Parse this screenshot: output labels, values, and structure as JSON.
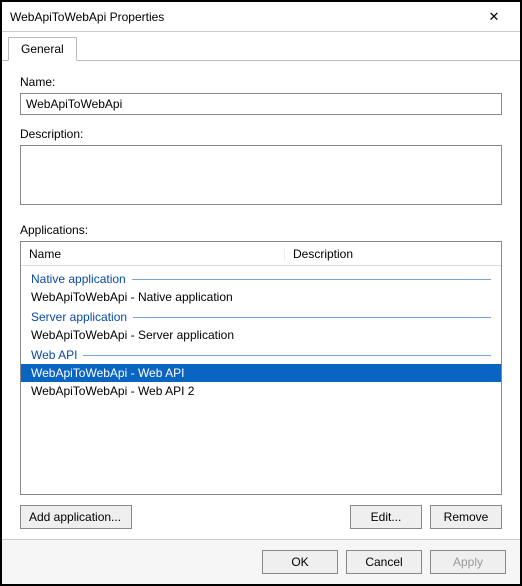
{
  "window": {
    "title": "WebApiToWebApi Properties",
    "close_glyph": "✕"
  },
  "tabs": {
    "general": "General"
  },
  "labels": {
    "name": "Name:",
    "description": "Description:",
    "applications": "Applications:"
  },
  "fields": {
    "name_value": "WebApiToWebApi",
    "description_value": ""
  },
  "apps_table": {
    "col_name": "Name",
    "col_desc": "Description",
    "groups": [
      {
        "title": "Native application",
        "rows": [
          {
            "name": "WebApiToWebApi - Native application",
            "selected": false
          }
        ]
      },
      {
        "title": "Server application",
        "rows": [
          {
            "name": "WebApiToWebApi - Server application",
            "selected": false
          }
        ]
      },
      {
        "title": "Web API",
        "rows": [
          {
            "name": "WebApiToWebApi - Web API",
            "selected": true
          },
          {
            "name": "WebApiToWebApi - Web API 2",
            "selected": false
          }
        ]
      }
    ]
  },
  "buttons": {
    "add_application": "Add application...",
    "edit": "Edit...",
    "remove": "Remove",
    "ok": "OK",
    "cancel": "Cancel",
    "apply": "Apply"
  }
}
